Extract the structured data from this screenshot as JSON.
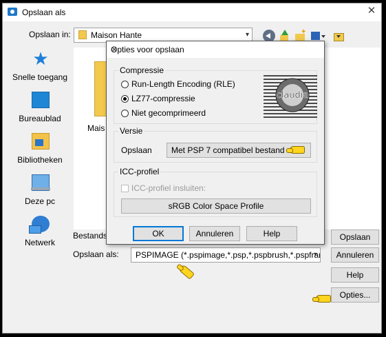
{
  "window": {
    "title": "Opslaan als",
    "close_glyph": "✕"
  },
  "location": {
    "label": "Opslaan in:",
    "folder": "Maison Hante"
  },
  "places": [
    {
      "label": "Snelle toegang",
      "icon": "star-icon"
    },
    {
      "label": "Bureaublad",
      "icon": "desktop-icon"
    },
    {
      "label": "Bibliotheken",
      "icon": "library-icon"
    },
    {
      "label": "Deze pc",
      "icon": "computer-icon"
    },
    {
      "label": "Netwerk",
      "icon": "network-icon"
    }
  ],
  "files": {
    "partial_label": "Mais"
  },
  "form": {
    "filename_label_partial": "Bestands",
    "savetype_label": "Opslaan als:",
    "savetype_value": "PSPIMAGE (*.pspimage,*.psp,*.pspbrush,*.pspframe,*"
  },
  "buttons": {
    "save": "Opslaan",
    "cancel": "Annuleren",
    "help": "Help",
    "options": "Opties..."
  },
  "dialog": {
    "title": "Opties voor opslaan",
    "compression": {
      "label": "Compressie",
      "options": [
        "Run-Length Encoding (RLE)",
        "LZ77-compressie",
        "Niet gecomprimeerd"
      ],
      "selected": "LZ77-compressie"
    },
    "version": {
      "label": "Versie",
      "field_label": "Opslaan",
      "value": "Met PSP 7 compatibel bestand"
    },
    "icc": {
      "label": "ICC-profiel",
      "checkbox": "ICC-profiel insluiten:",
      "profile_button": "sRGB Color Space Profile"
    },
    "buttons": {
      "ok": "OK",
      "cancel": "Annuleren",
      "help": "Help"
    },
    "watermark": "claudia"
  },
  "colors": {
    "accent": "#0078d7",
    "pointer_hand": "#ffd51f",
    "folder": "#f2c94c"
  }
}
